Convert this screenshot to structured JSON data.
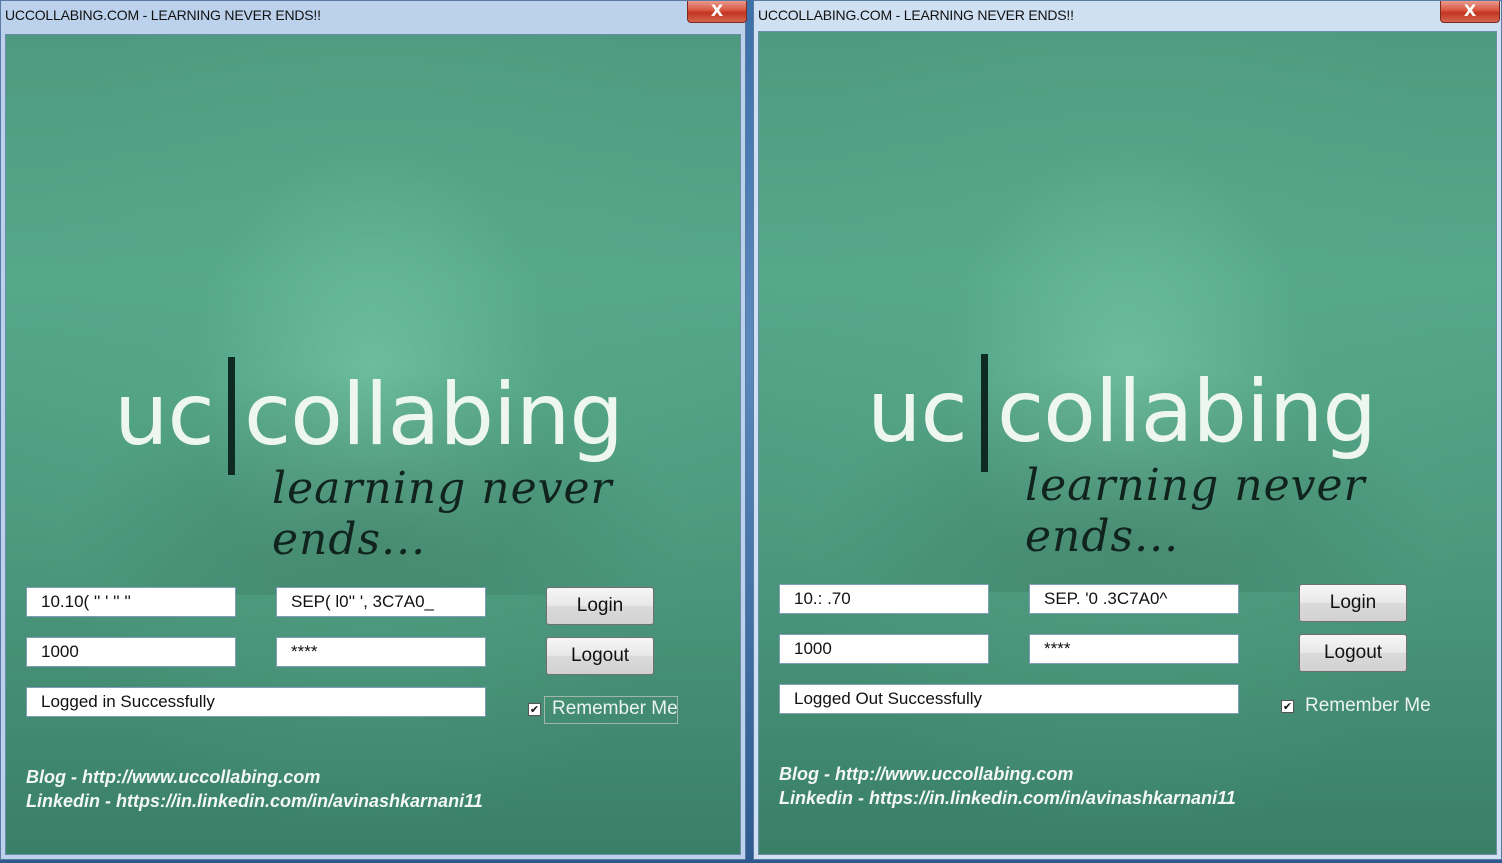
{
  "windows": [
    {
      "title": "UCCOLLABING.COM - LEARNING NEVER ENDS!!",
      "close_glyph": "X",
      "logo": {
        "left": "uc",
        "right": "collabing",
        "tagline": "learning never ends..."
      },
      "ip_value": "10.10(  ''  '  '' ''",
      "device_value": "SEP(  l0'' ',  3C7A0_",
      "extension_value": "1000",
      "password_value": "****",
      "status_value": "Logged in Successfully",
      "login_label": "Login",
      "logout_label": "Logout",
      "remember_label": "Remember Me",
      "remember_checked": true,
      "remember_check_glyph": "✔",
      "blog_link": "Blog - http://www.uccollabing.com",
      "linkedin_link": "Linkedin - https://in.linkedin.com/in/avinashkarnani11"
    },
    {
      "title": "UCCOLLABING.COM - LEARNING NEVER ENDS!!",
      "close_glyph": "X",
      "logo": {
        "left": "uc",
        "right": "collabing",
        "tagline": "learning never ends..."
      },
      "ip_value": "10.:               .70",
      "device_value": "SEP.     '0  .3C7A0^",
      "extension_value": "1000",
      "password_value": "****",
      "status_value": "Logged Out Successfully",
      "login_label": "Login",
      "logout_label": "Logout",
      "remember_label": "Remember Me",
      "remember_checked": true,
      "remember_check_glyph": "✔",
      "blog_link": "Blog - http://www.uccollabing.com",
      "linkedin_link": "Linkedin - https://in.linkedin.com/in/avinashkarnani11"
    }
  ]
}
